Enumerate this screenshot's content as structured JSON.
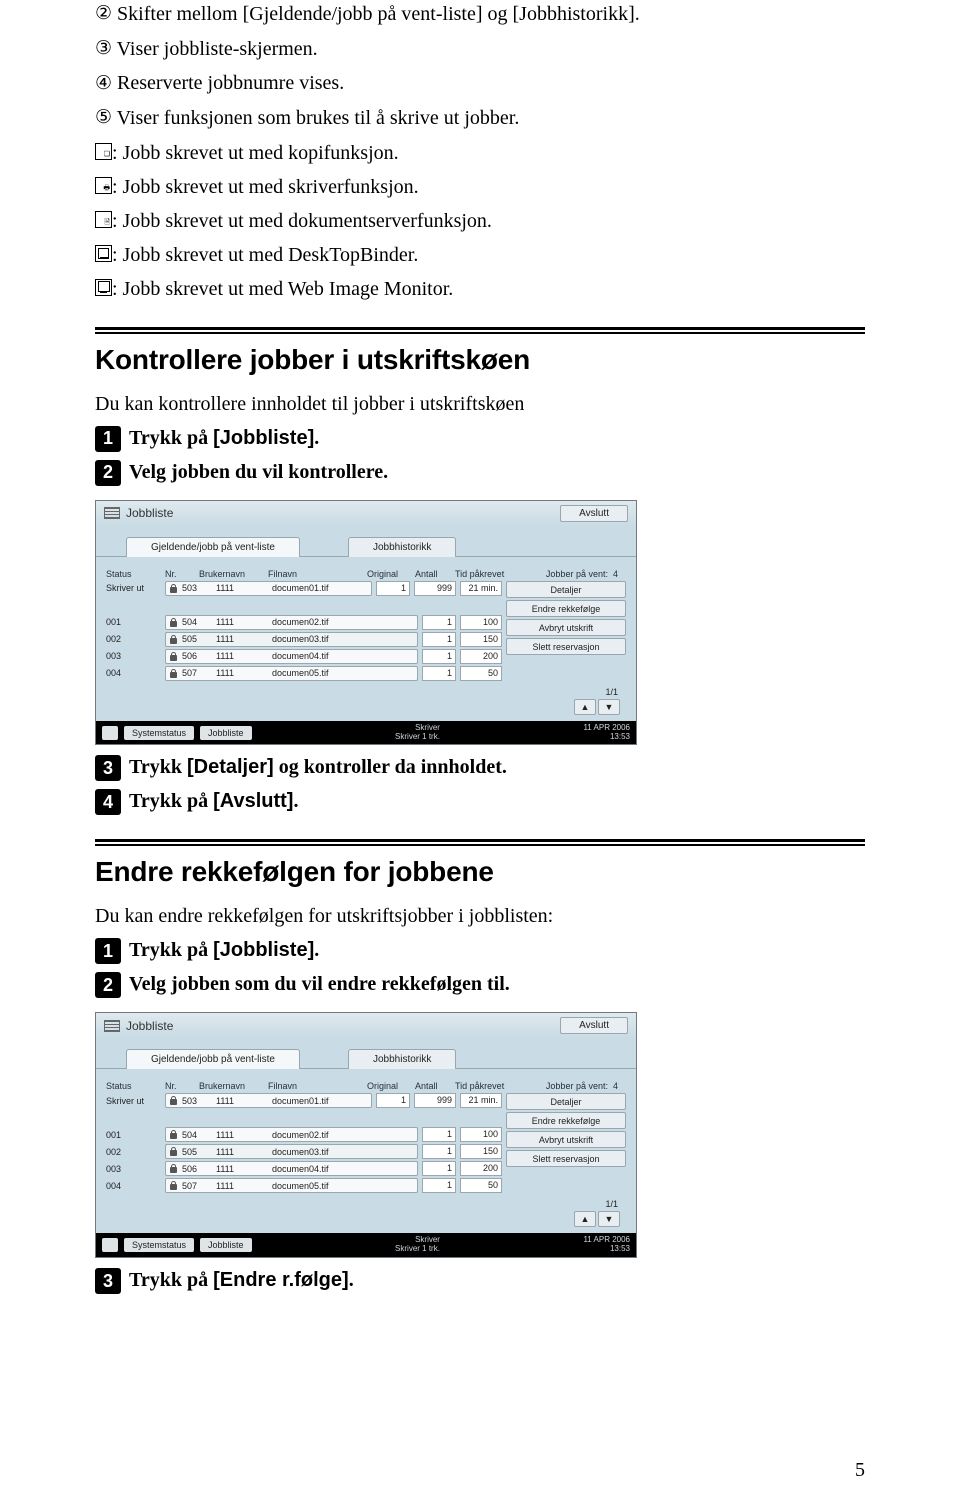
{
  "intro": {
    "items": [
      {
        "num": "②",
        "pre": " Skifter mellom ",
        "links": "[Gjeldende/jobb på vent-liste]",
        "mid": " og ",
        "links2": "[Jobbhistorikk]",
        "post": "."
      },
      {
        "num": "③",
        "text": " Viser jobbliste-skjermen."
      },
      {
        "num": "④",
        "text": " Reserverte jobbnumre vises."
      },
      {
        "num": "⑤",
        "text": " Viser funksjonen som brukes til å skrive ut jobber."
      }
    ],
    "icon_items": [
      {
        "mark": "a",
        "text": ": Jobb skrevet ut med kopifunksjon."
      },
      {
        "mark": "b",
        "text": ": Jobb skrevet ut med skriverfunksjon."
      },
      {
        "mark": "c",
        "text": ": Jobb skrevet ut med dokumentserverfunksjon."
      },
      {
        "kind": "desk",
        "text": ": Jobb skrevet ut med DeskTopBinder."
      },
      {
        "kind": "web",
        "text": ": Jobb skrevet ut med Web Image Monitor."
      }
    ]
  },
  "section1": {
    "heading": "Kontrollere jobber i utskriftskøen",
    "lead": "Du kan kontrollere innholdet til jobber i utskriftskøen",
    "step1_pre": "Trykk på ",
    "step1_link": "[Jobbliste]",
    "step1_post": ".",
    "step2": "Velg jobben du vil kontrollere.",
    "step3_pre": "Trykk ",
    "step3_link": "[Detaljer]",
    "step3_post": " og kontroller da innholdet.",
    "step4_pre": "Trykk på ",
    "step4_link": "[Avslutt]",
    "step4_post": "."
  },
  "section2": {
    "heading": "Endre rekkefølgen for jobbene",
    "lead": "Du kan endre rekkefølgen for utskriftsjobber i jobblisten:",
    "step1_pre": "Trykk på ",
    "step1_link": "[Jobbliste]",
    "step1_post": ".",
    "step2": "Velg jobben som du vil endre rekkefølgen til.",
    "step3_pre": "Trykk på ",
    "step3_link": "[Endre r.følge]",
    "step3_post": "."
  },
  "screenshot": {
    "title": "Jobbliste",
    "exit": "Avslutt",
    "tab_active": "Gjeldende/jobb på vent-liste",
    "tab2": "Jobbhistorikk",
    "hdr": {
      "status": "Status",
      "nr": "Nr.",
      "user": "Brukernavn",
      "file": "Filnavn",
      "orig": "Original",
      "ant": "Antall",
      "tid": "Tid påkrevet",
      "vent": "Jobber på vent:",
      "vent_n": "4"
    },
    "rows": [
      {
        "status": "Skriver ut",
        "nr": "503",
        "user": "1111",
        "file": "documen01.tif",
        "a": "1",
        "b": "999",
        "c": "21 min.",
        "sel": false
      },
      {
        "status": "001",
        "nr": "504",
        "user": "1111",
        "file": "documen02.tif",
        "a": "1",
        "b": "100",
        "c": "",
        "sel": false
      },
      {
        "status": "002",
        "nr": "505",
        "user": "1111",
        "file": "documen03.tif",
        "a": "1",
        "b": "150",
        "c": "",
        "sel": true
      },
      {
        "status": "003",
        "nr": "506",
        "user": "1111",
        "file": "documen04.tif",
        "a": "1",
        "b": "200",
        "c": "",
        "sel": false
      },
      {
        "status": "004",
        "nr": "507",
        "user": "1111",
        "file": "documen05.tif",
        "a": "1",
        "b": "50",
        "c": "",
        "sel": false
      }
    ],
    "rbtns": [
      "Detaljer",
      "Endre rekkefølge",
      "Avbryt utskrift",
      "Slett reservasjon"
    ],
    "pager": "1/1",
    "bottom": {
      "b1": "Systemstatus",
      "b2": "Jobbliste",
      "s1": "Skriver",
      "s2": "Skriver 1 trk.",
      "date": "11 APR 2006",
      "time": "13:53"
    }
  },
  "page_number": "5"
}
